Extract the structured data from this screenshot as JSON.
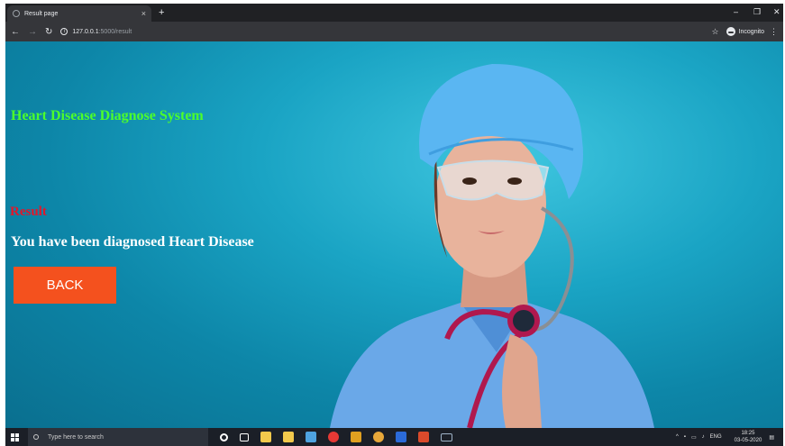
{
  "browser": {
    "tab_title": "Result page",
    "tab_close": "×",
    "new_tab": "+",
    "url_host": "127.0.0.1",
    "url_path": ":5000/result",
    "incognito_label": "Incognito",
    "window_controls": [
      "–",
      "❐",
      "✕"
    ]
  },
  "page": {
    "title": "Heart Disease Diagnose System",
    "result_label": "Result",
    "result_text": "You have been diagnosed Heart Disease",
    "back_button": "BACK",
    "colors": {
      "title": "#4cff2b",
      "result_label": "#e0182b",
      "button": "#f4511e"
    }
  },
  "taskbar": {
    "search_placeholder": "Type here to search",
    "language": "ENG",
    "time": "18:25",
    "date": "03-05-2020"
  }
}
